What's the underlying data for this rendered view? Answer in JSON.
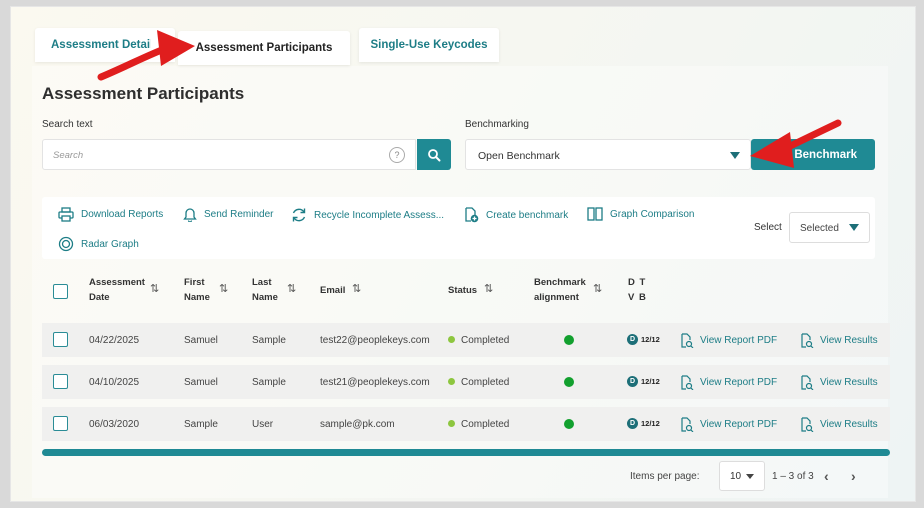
{
  "tabs": [
    {
      "label": "Assessment Details",
      "active": false
    },
    {
      "label": "Assessment Participants",
      "active": true
    },
    {
      "label": "Single-Use Keycodes",
      "active": false
    }
  ],
  "page_title": "Assessment Participants",
  "search": {
    "label": "Search text",
    "placeholder": "Search",
    "help": "?"
  },
  "benchmarking": {
    "label": "Benchmarking",
    "value": "Open Benchmark",
    "button_label": "Benchmark"
  },
  "toolbar": {
    "download_reports": "Download Reports",
    "send_reminder": "Send Reminder",
    "recycle_incomplete": "Recycle Incomplete Assess...",
    "create_benchmark": "Create benchmark",
    "graph_comparison": "Graph Comparison",
    "radar_graph": "Radar Graph",
    "select_label": "Select",
    "select_value": "Selected"
  },
  "table": {
    "headers": {
      "date": "Assessment Date",
      "first": "First Name",
      "last": "Last Name",
      "email": "Email",
      "status": "Status",
      "benchmark": "Benchmark alignment",
      "dtvb": "D T V B"
    },
    "sort_glyph": "⇅",
    "rows": [
      {
        "date": "04/22/2025",
        "first": "Samuel",
        "last": "Sample",
        "email": "test22@peoplekeys.com",
        "status": "Completed",
        "badge_letter": "D",
        "badge_score": "12/12",
        "report": "View Report PDF",
        "results": "View Results"
      },
      {
        "date": "04/10/2025",
        "first": "Samuel",
        "last": "Sample",
        "email": "test21@peoplekeys.com",
        "status": "Completed",
        "badge_letter": "D",
        "badge_score": "12/12",
        "report": "View Report PDF",
        "results": "View Results"
      },
      {
        "date": "06/03/2020",
        "first": "Sample",
        "last": "User",
        "email": "sample@pk.com",
        "status": "Completed",
        "badge_letter": "D",
        "badge_score": "12/12",
        "report": "View Report PDF",
        "results": "View Results"
      }
    ]
  },
  "pagination": {
    "items_label": "Items per page:",
    "page_size": "10",
    "range": "1 – 3 of 3",
    "prev": "‹",
    "next": "›"
  },
  "colors": {
    "accent": "#1f8a94",
    "arrow": "#e01e1e",
    "status_completed": "#8dc63f",
    "benchmark_dot": "#12a02e"
  }
}
